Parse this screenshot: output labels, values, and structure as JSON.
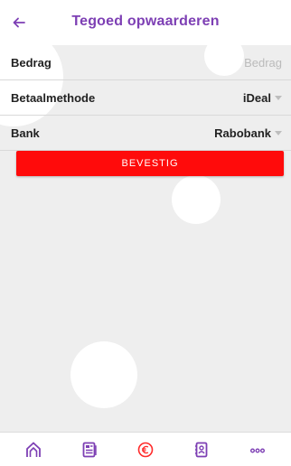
{
  "header": {
    "title": "Tegoed opwaarderen",
    "back_icon": "arrow-left-icon"
  },
  "form": {
    "amount": {
      "label": "Bedrag",
      "placeholder": "Bedrag",
      "value": ""
    },
    "method": {
      "label": "Betaalmethode",
      "value": "iDeal"
    },
    "bank": {
      "label": "Bank",
      "value": "Rabobank"
    }
  },
  "confirm_label": "BEVESTIG",
  "bottom_nav": [
    {
      "icon": "home-icon"
    },
    {
      "icon": "news-icon"
    },
    {
      "icon": "euro-icon"
    },
    {
      "icon": "contacts-icon"
    },
    {
      "icon": "more-icon"
    }
  ],
  "colors": {
    "accent": "#7d3fb4",
    "confirm": "#ff0b0b",
    "background": "#eeeeee"
  }
}
